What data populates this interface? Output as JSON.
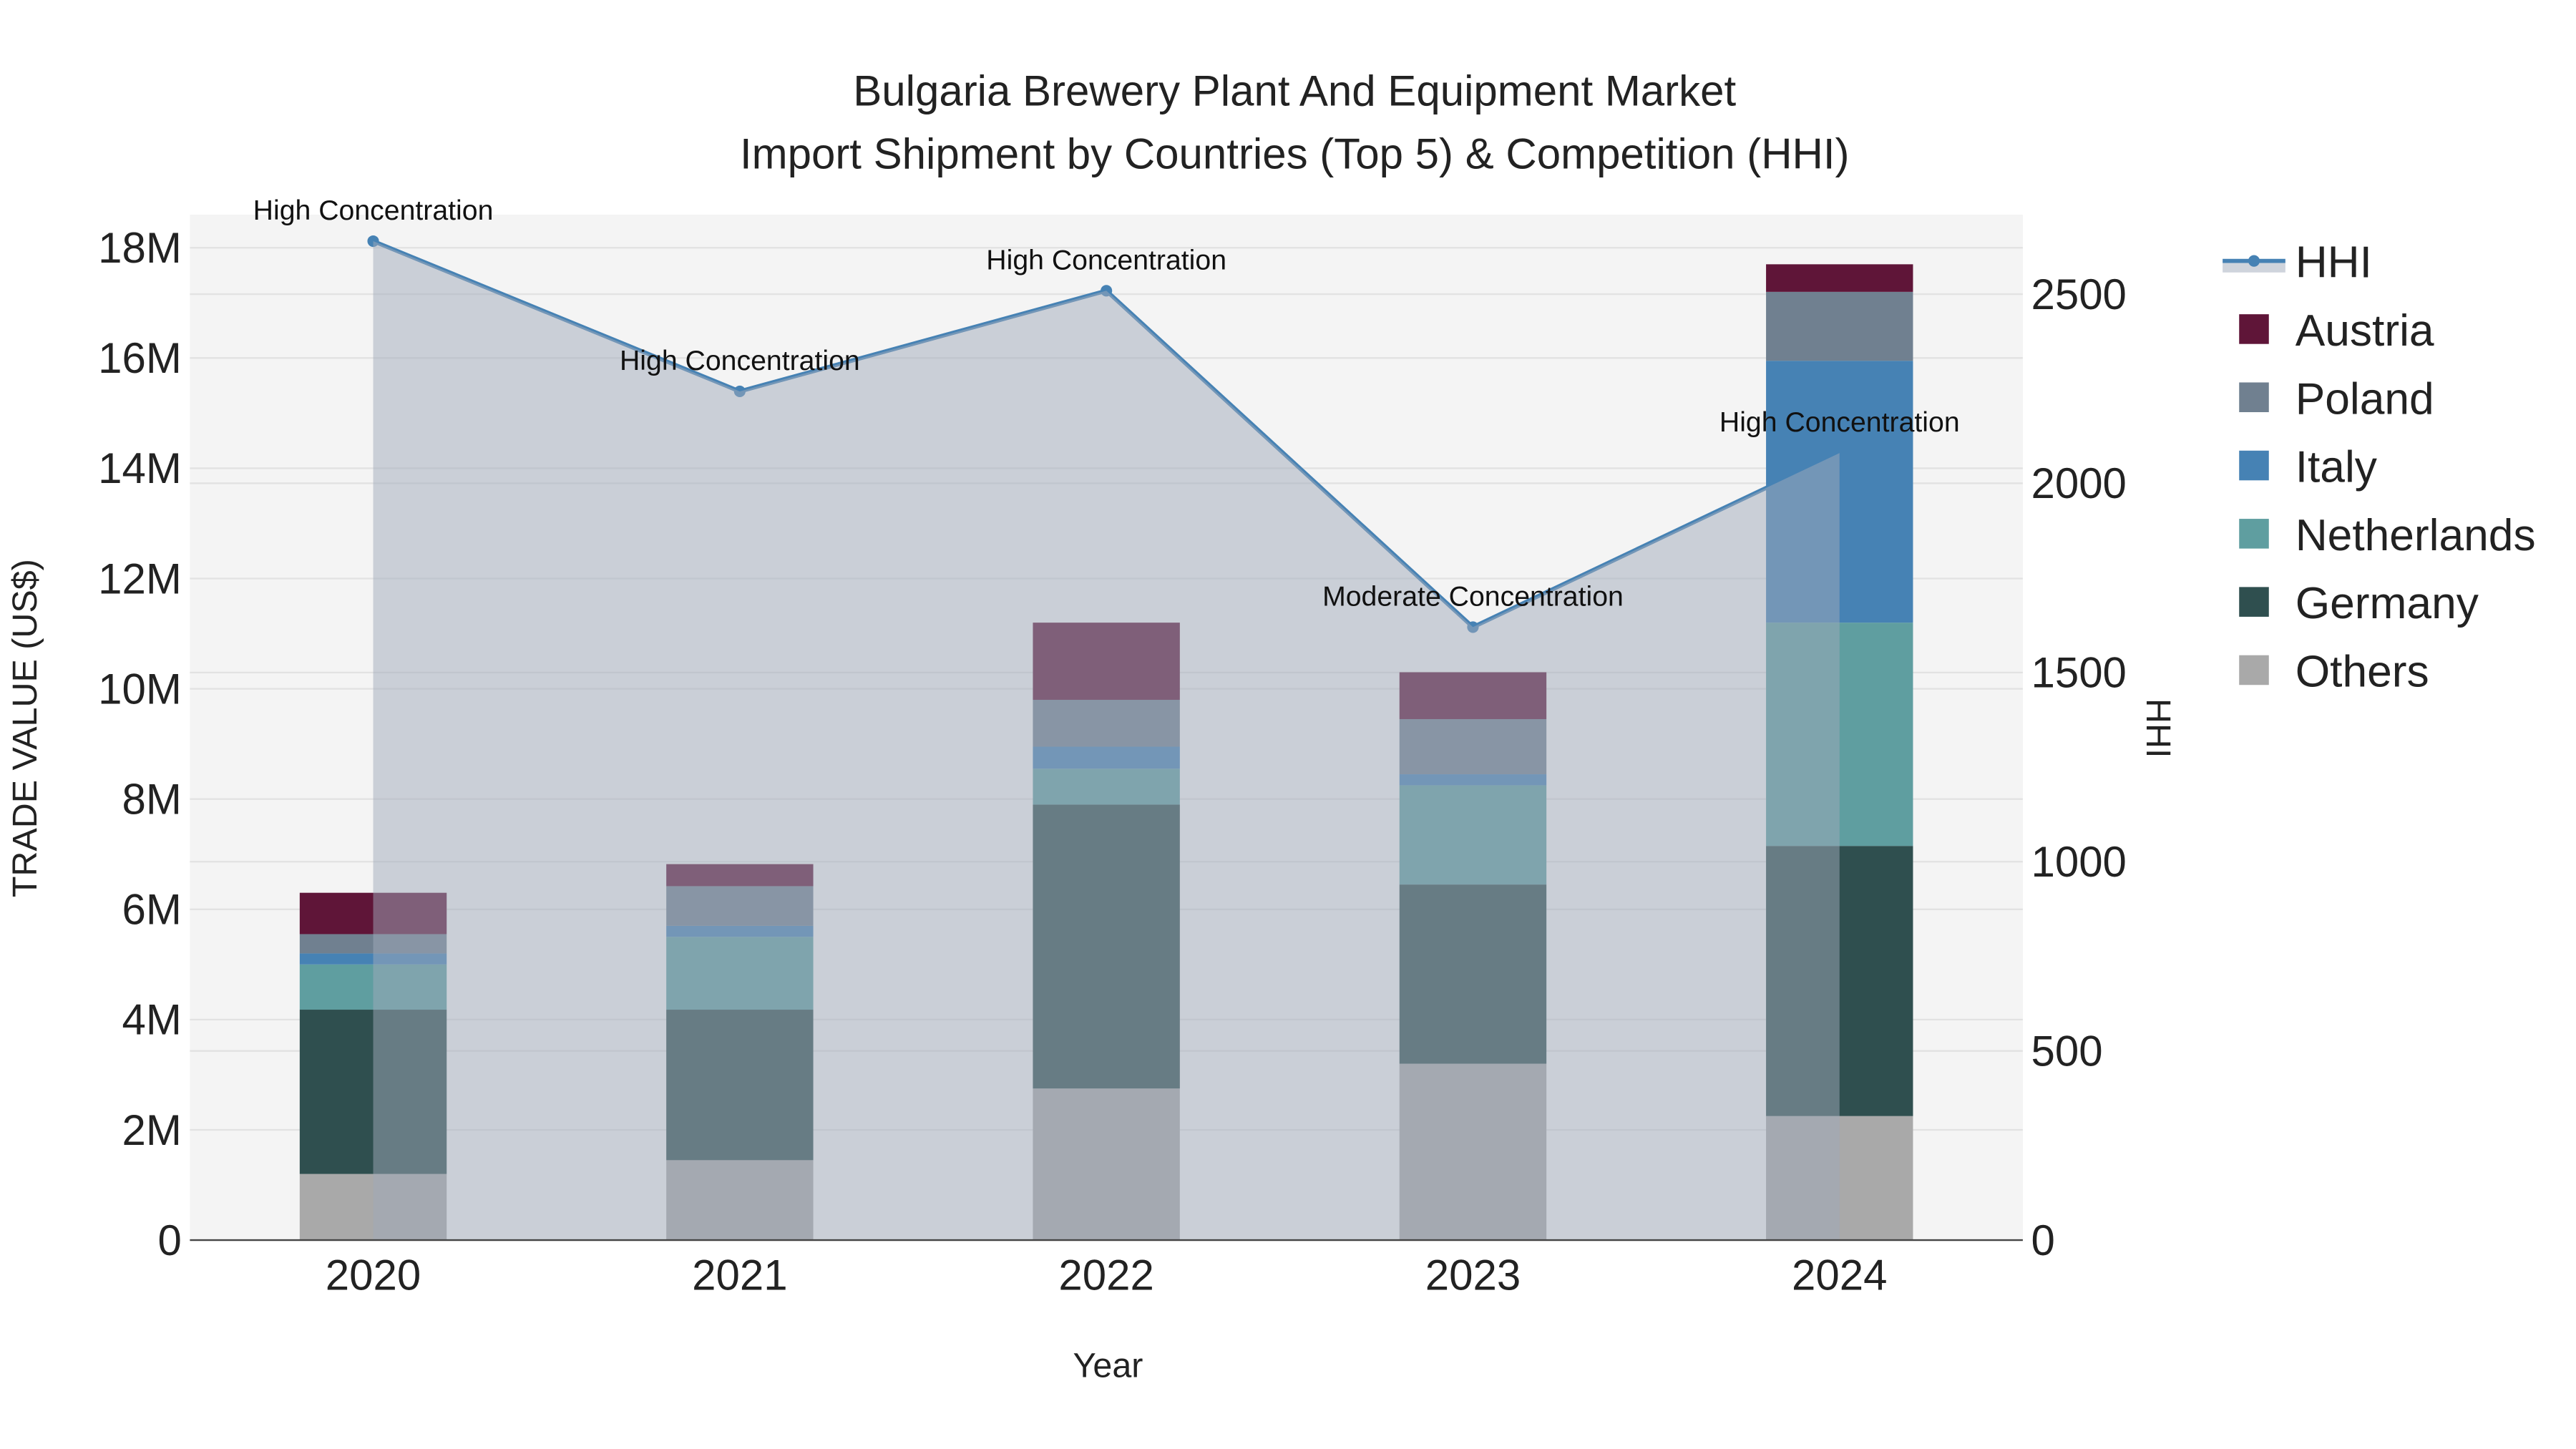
{
  "chart_data": {
    "type": "bar",
    "title_line1": "Bulgaria Brewery Plant And Equipment Market",
    "title_line2": "Import Shipment by Countries (Top 5) & Competition (HHI)",
    "xlabel": "Year",
    "ylabel": "TRADE VALUE (US$)",
    "y2label": "HHI",
    "ylim": [
      0,
      18600000
    ],
    "y2lim": [
      0,
      2710
    ],
    "yticks": [
      0,
      2000000,
      4000000,
      6000000,
      8000000,
      10000000,
      12000000,
      14000000,
      16000000,
      18000000
    ],
    "ytick_labels": [
      "0",
      "2M",
      "4M",
      "6M",
      "8M",
      "10M",
      "12M",
      "14M",
      "16M",
      "18M"
    ],
    "y2ticks": [
      0,
      500,
      1000,
      1500,
      2000,
      2500
    ],
    "y2tick_labels": [
      "0",
      "500",
      "1000",
      "1500",
      "2000",
      "2500"
    ],
    "categories": [
      "2020",
      "2021",
      "2022",
      "2023",
      "2024"
    ],
    "series": [
      {
        "name": "Others",
        "color": "#a9a9a9",
        "values": [
          1200000,
          1450000,
          2750000,
          3200000,
          2250000
        ]
      },
      {
        "name": "Germany",
        "color": "#2f4f4f",
        "values": [
          2980000,
          2730000,
          5150000,
          3250000,
          4900000
        ]
      },
      {
        "name": "Netherlands",
        "color": "#5f9ea0",
        "values": [
          820000,
          1320000,
          650000,
          1800000,
          4050000
        ]
      },
      {
        "name": "Italy",
        "color": "#4682b4",
        "values": [
          200000,
          200000,
          400000,
          200000,
          4750000
        ]
      },
      {
        "name": "Poland",
        "color": "#708090",
        "values": [
          350000,
          720000,
          850000,
          1000000,
          1250000
        ]
      },
      {
        "name": "Austria",
        "color": "#5f1538",
        "values": [
          750000,
          400000,
          1400000,
          850000,
          500000
        ]
      }
    ],
    "hhi": {
      "name": "HHI",
      "color": "#4682b4",
      "values": [
        2640,
        2243,
        2509,
        1620,
        2080
      ],
      "annotations": [
        "High Concentration",
        "High Concentration",
        "High Concentration",
        "Moderate Concentration",
        "High Concentration"
      ]
    },
    "legend_order": [
      "HHI",
      "Austria",
      "Poland",
      "Italy",
      "Netherlands",
      "Germany",
      "Others"
    ],
    "legend_position": "right",
    "grid": true
  }
}
